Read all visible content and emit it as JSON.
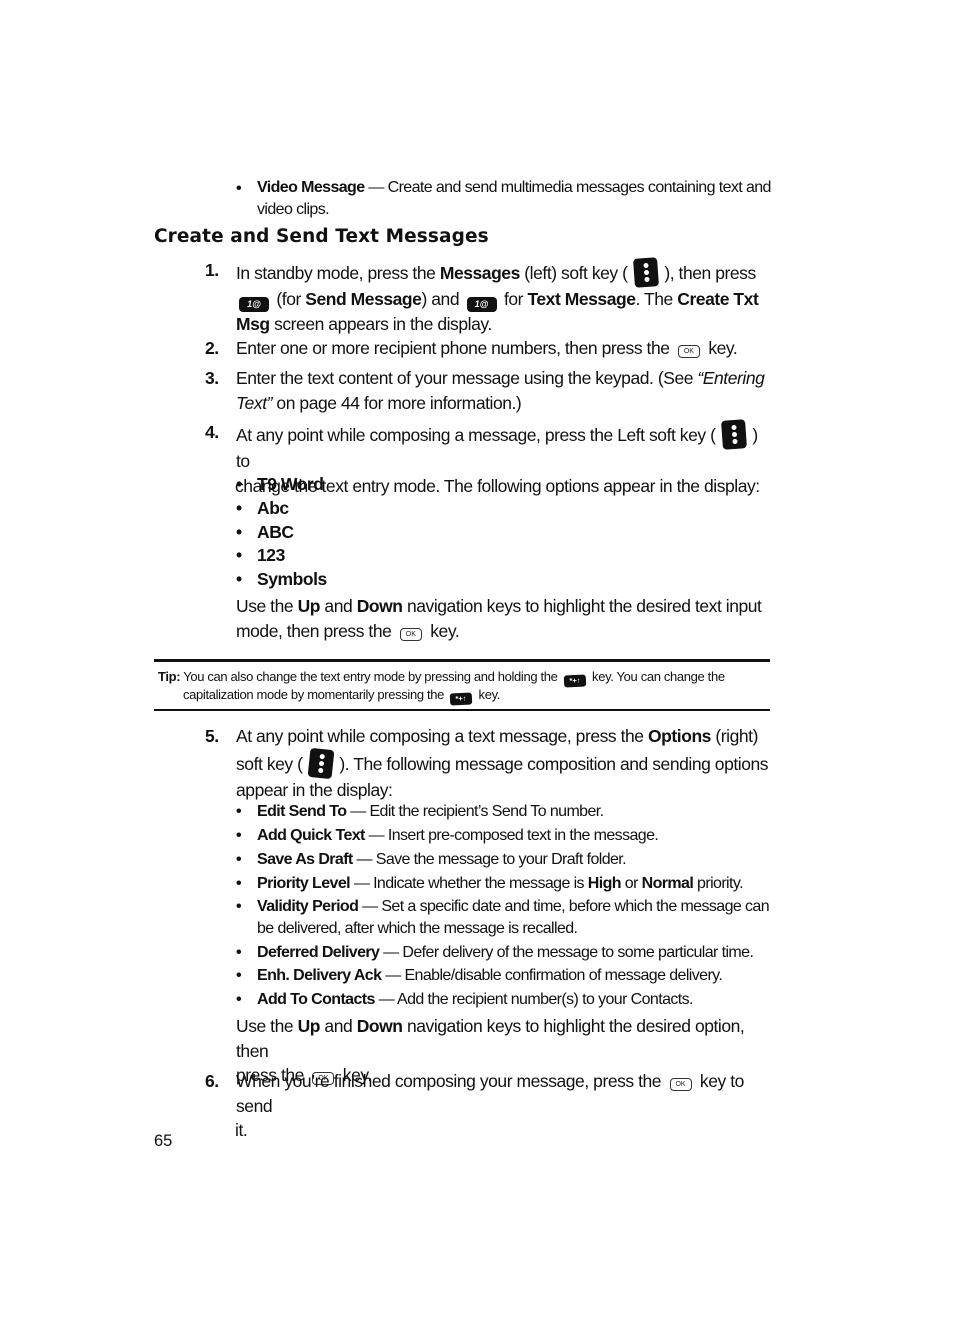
{
  "intro_bullet": {
    "term": "Video Message",
    "dash": " — ",
    "desc_line1": "Create and send multimedia messages containing text and",
    "desc_line2": "video clips."
  },
  "section": {
    "title": "Create and Send Text Messages"
  },
  "icons": {
    "left_softkey": "left-softkey-icon",
    "right_softkey": "right-softkey-icon",
    "key_1": "key-1-icon",
    "ok_key": "ok-key-icon",
    "star_key": "star-shift-key-icon",
    "key1_glyph": "1@",
    "ok_glyph": "OK",
    "star_glyph": "*+↑"
  },
  "steps": {
    "s1": {
      "num": "1.",
      "a": "In standby mode, press the ",
      "b_messages": "Messages",
      "c": " (left) soft key ( ",
      "d": " ), then press",
      "e": " (for ",
      "b_send": "Send Message",
      "f": ") and ",
      "g": " for ",
      "b_text": "Text Message",
      "h": ". The ",
      "b_create1": "Create Txt",
      "b_create2": "Msg",
      "i": " screen appears in the display."
    },
    "s2": {
      "num": "2.",
      "a": "Enter one or more recipient phone numbers, then press the ",
      "b": " key."
    },
    "s3": {
      "num": "3.",
      "a": "Enter the text content of your message using the keypad. (See ",
      "i1": "“Entering",
      "i2": "Text”",
      "b": " on page 44 for more information.)"
    },
    "s4": {
      "num": "4.",
      "a": "At any point while composing a message, press the Left soft key ( ",
      "b": " ) to",
      "c": "change the text entry mode. The following options appear in the display:",
      "options": [
        "T9 Word",
        "Abc",
        "ABC",
        "123",
        "Symbols"
      ],
      "use_a": "Use the ",
      "use_up": "Up",
      "use_and": " and ",
      "use_down": "Down",
      "use_b": " navigation keys to highlight the desired text input",
      "use_c": "mode, then press the ",
      "use_d": " key."
    },
    "s5": {
      "num": "5.",
      "a": "At any point while composing a text message, press the ",
      "b_options": "Options",
      "c": " (right)",
      "d": "soft key ( ",
      "e": " ). The following message composition and sending options",
      "f": "appear in the display:",
      "options": [
        {
          "term": "Edit Send To",
          "desc": "Edit the recipient’s Send To number."
        },
        {
          "term": "Add Quick Text",
          "desc": "Insert pre-composed text in the message."
        },
        {
          "term": "Save As Draft",
          "desc": "Save the message to your Draft folder."
        },
        {
          "term": "Priority Level",
          "desc_a": "Indicate whether the message is ",
          "high": "High",
          "or": " or ",
          "normal": "Normal",
          "desc_b": " priority."
        },
        {
          "term": "Validity Period",
          "desc": "Set a specific date and time, before which the message can",
          "desc2": "be delivered, after which the message is recalled."
        },
        {
          "term": "Deferred Delivery",
          "desc": "Defer delivery of the message to some particular time."
        },
        {
          "term": "Enh. Delivery Ack",
          "desc": "Enable/disable confirmation of message delivery."
        },
        {
          "term": "Add To Contacts",
          "desc": "Add the recipient number(s) to your Contacts."
        }
      ],
      "dash": " — ",
      "use_a": "Use the ",
      "use_up": "Up",
      "use_and": " and ",
      "use_down": "Down",
      "use_b": " navigation keys to highlight the desired option, then",
      "use_c": "press the ",
      "use_d": " key."
    },
    "s6": {
      "num": "6.",
      "a": "When you’re finished composing your message, press the ",
      "b": " key to send",
      "c": "it."
    }
  },
  "tip": {
    "label": "Tip:",
    "line1_a": " You can also change the text entry mode by pressing and holding the ",
    "line1_b": " key. You can change the",
    "line2_a": "capitalization mode by momentarily pressing the ",
    "line2_b": " key."
  },
  "bullet_char": "•",
  "page_number": "65"
}
